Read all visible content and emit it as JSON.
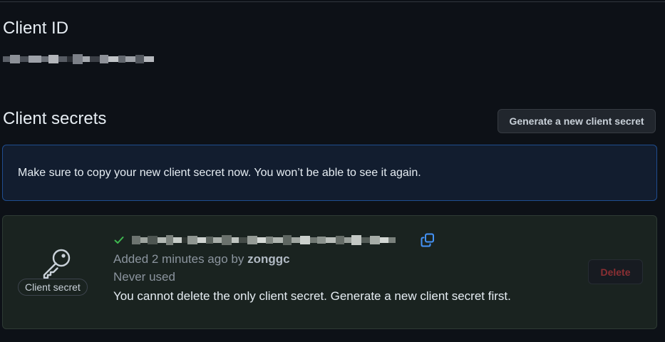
{
  "client_id": {
    "heading": "Client ID",
    "value_redacted": true
  },
  "client_secrets": {
    "heading": "Client secrets",
    "generate_button_label": "Generate a new client secret",
    "flash_message": "Make sure to copy your new client secret now. You won’t be able to see it again.",
    "secret": {
      "badge_label": "Client secret",
      "value_redacted": true,
      "added_prefix": "Added 2 minutes ago by ",
      "added_by": "zonggc",
      "usage": "Never used",
      "warning": "You cannot delete the only client secret. Generate a new client secret first.",
      "delete_label": "Delete",
      "delete_disabled": true,
      "icons": {
        "key": "key-icon",
        "check": "check-icon",
        "copy": "copy-icon"
      }
    }
  },
  "colors": {
    "background": "#0d1117",
    "flash_border": "#1f4d8f",
    "flash_background": "#121d2f",
    "card_background": "#1a2320",
    "check_green": "#3fb950",
    "copy_blue": "#4493f8",
    "delete_red": "#8a2f33"
  }
}
